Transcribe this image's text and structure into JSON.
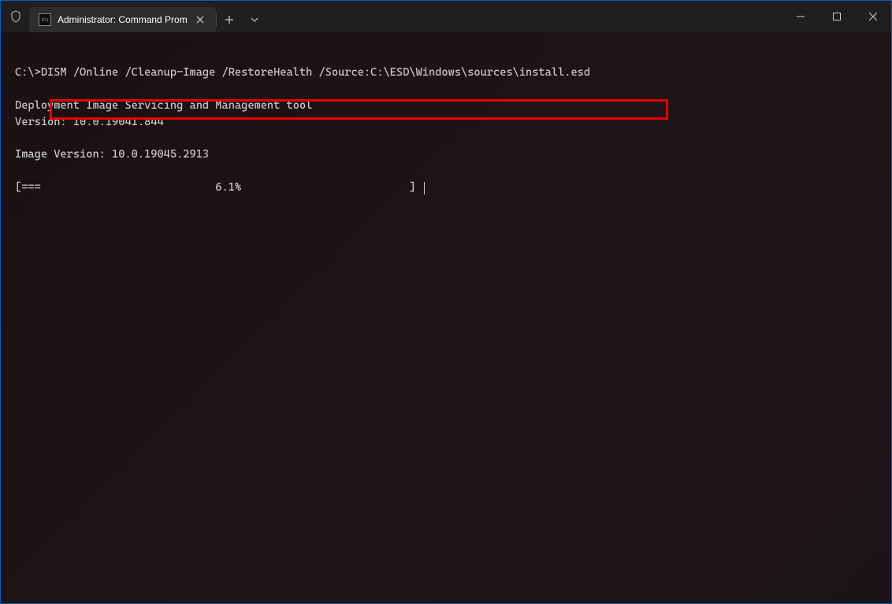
{
  "tab": {
    "title": "Administrator: Command Prom",
    "icon_label": "C:\\"
  },
  "terminal": {
    "prompt": "C:\\>",
    "command": "DISM /Online /Cleanup-Image /RestoreHealth /Source:C:\\ESD\\Windows\\sources\\install.esd",
    "output_line1": "Deployment Image Servicing and Management tool",
    "output_line2": "Version: 10.0.19041.844",
    "output_line3": "Image Version: 10.0.19045.2913",
    "progress_line": "[===                           6.1%                          ] "
  }
}
